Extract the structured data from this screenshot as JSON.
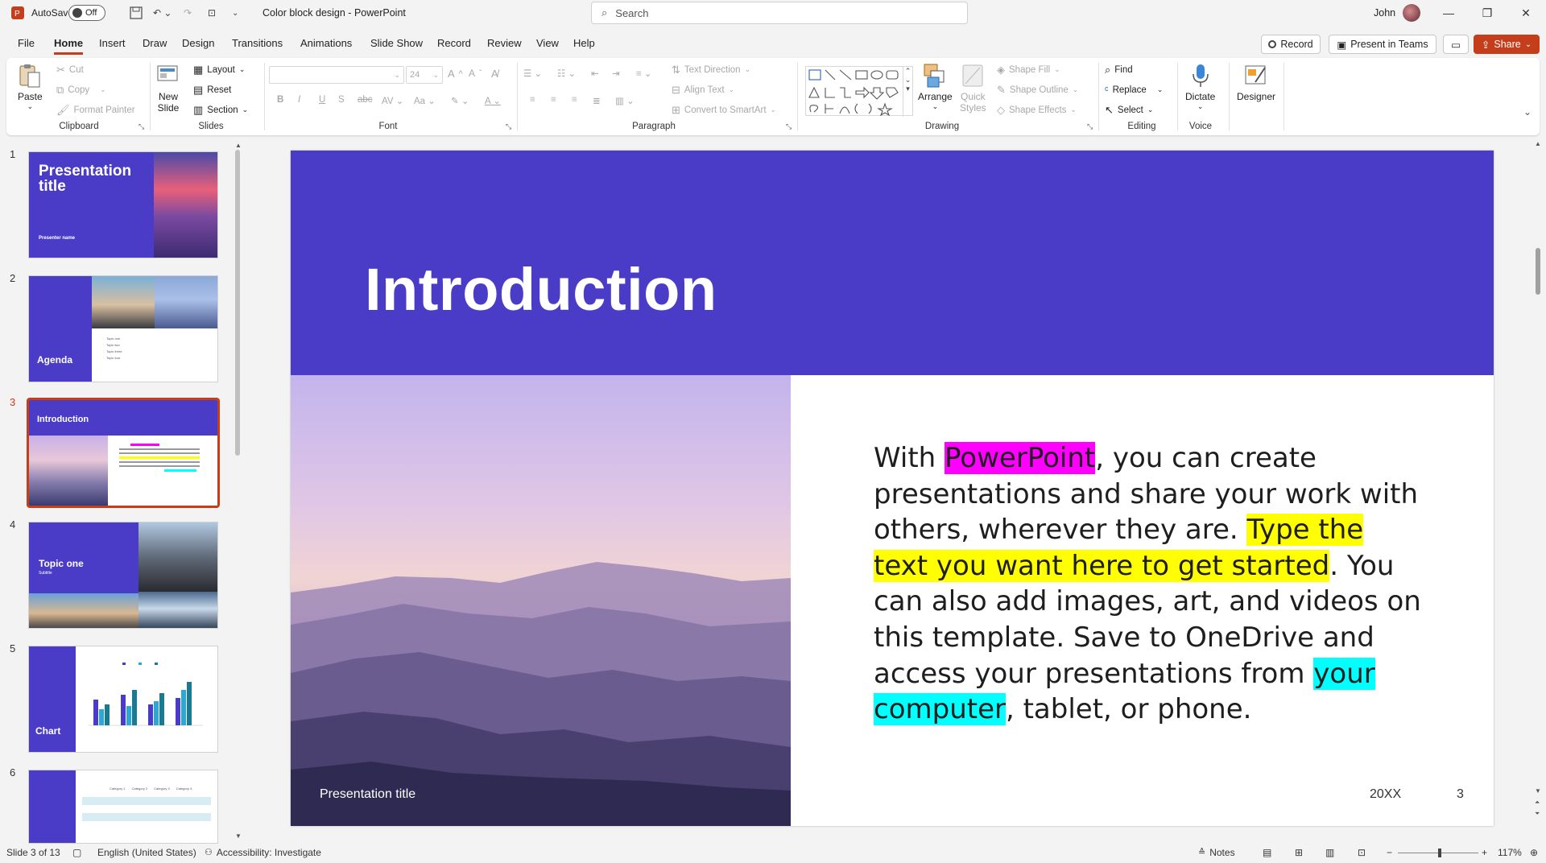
{
  "titlebar": {
    "autosave_label": "AutoSave",
    "autosave_state": "Off",
    "doc_title": "Color block design  -  PowerPoint",
    "search_placeholder": "Search",
    "user_name": "John"
  },
  "menu": {
    "tabs": [
      {
        "label": "File"
      },
      {
        "label": "Home"
      },
      {
        "label": "Insert"
      },
      {
        "label": "Draw"
      },
      {
        "label": "Design"
      },
      {
        "label": "Transitions"
      },
      {
        "label": "Animations"
      },
      {
        "label": "Slide Show"
      },
      {
        "label": "Record"
      },
      {
        "label": "Review"
      },
      {
        "label": "View"
      },
      {
        "label": "Help"
      }
    ],
    "active_tab": "Home",
    "record_label": "Record",
    "present_teams_label": "Present in Teams",
    "share_label": "Share"
  },
  "ribbon": {
    "clipboard": {
      "paste": "Paste",
      "cut": "Cut",
      "copy": "Copy",
      "format_painter": "Format Painter",
      "label": "Clipboard"
    },
    "slides": {
      "new_slide_line1": "New",
      "new_slide_line2": "Slide",
      "layout": "Layout",
      "reset": "Reset",
      "section": "Section",
      "label": "Slides"
    },
    "font": {
      "font_name": "",
      "font_size": "24",
      "label": "Font"
    },
    "paragraph": {
      "text_direction": "Text Direction",
      "align_text": "Align Text",
      "convert_smartart": "Convert to SmartArt",
      "label": "Paragraph"
    },
    "drawing": {
      "arrange": "Arrange",
      "quick_styles_line1": "Quick",
      "quick_styles_line2": "Styles",
      "shape_fill": "Shape Fill",
      "shape_outline": "Shape Outline",
      "shape_effects": "Shape Effects",
      "label": "Drawing"
    },
    "editing": {
      "find": "Find",
      "replace": "Replace",
      "select": "Select",
      "label": "Editing"
    },
    "voice": {
      "dictate": "Dictate",
      "label": "Voice"
    },
    "designer": {
      "label": "Designer"
    }
  },
  "thumbnails": [
    {
      "num": "1",
      "title": "Presentation title",
      "sub": "Presenter name"
    },
    {
      "num": "2",
      "title": "Agenda",
      "items": [
        "Topic one",
        "Topic two",
        "Topic three",
        "Topic four"
      ]
    },
    {
      "num": "3",
      "title": "Introduction"
    },
    {
      "num": "4",
      "title": "Topic one",
      "sub": "Subtitle"
    },
    {
      "num": "5",
      "title": "Chart"
    },
    {
      "num": "6",
      "headers": [
        "Category 1",
        "Category 2",
        "Category 3",
        "Category 4"
      ]
    }
  ],
  "slide": {
    "title": "Introduction",
    "body_parts": [
      {
        "text": "With "
      },
      {
        "text": "PowerPoint",
        "hl": "magenta"
      },
      {
        "text": ", you can create presentations and share your work with others, wherever they are. "
      },
      {
        "text": "Type the text you want here to get started",
        "hl": "yellow"
      },
      {
        "text": ". You can also add images, art, and videos on this template. Save to OneDrive and access your presentations from "
      },
      {
        "text": "your computer",
        "hl": "cyan"
      },
      {
        "text": ", tablet, or phone."
      }
    ],
    "footer": "Presentation title",
    "date": "20XX",
    "number": "3"
  },
  "status": {
    "slide_info": "Slide 3 of 13",
    "language": "English (United States)",
    "accessibility": "Accessibility: Investigate",
    "notes": "Notes",
    "zoom": "117%"
  },
  "colors": {
    "accent": "#c43e1c",
    "slide_purple": "#4b3cc8"
  }
}
